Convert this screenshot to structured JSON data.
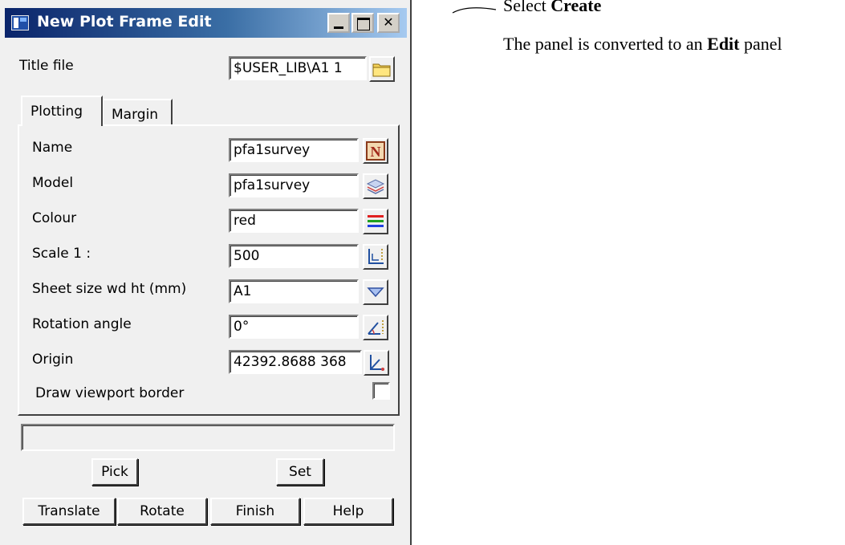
{
  "window": {
    "title": "New Plot Frame Edit",
    "title_file_label": "Title file",
    "title_file_value": "$USER_LIB\\A1 1"
  },
  "tabs": [
    {
      "label": "Plotting",
      "active": true
    },
    {
      "label": "Margin",
      "active": false
    }
  ],
  "fields": {
    "name": {
      "label": "Name",
      "value": "pfa1survey",
      "icon": "name-icon"
    },
    "model": {
      "label": "Model",
      "value": "pfa1survey",
      "icon": "layers-icon"
    },
    "colour": {
      "label": "Colour",
      "value": "red",
      "icon": "colour-bars-icon"
    },
    "scale": {
      "label": "Scale 1 :",
      "value": "500",
      "icon": "scale-icon"
    },
    "sheet": {
      "label": "Sheet size wd ht (mm)",
      "value": "A1",
      "icon": "chevron-down-icon"
    },
    "rotation": {
      "label": "Rotation angle",
      "value": "0°",
      "icon": "angle-icon"
    },
    "origin": {
      "label": "Origin",
      "value": "42392.8688 368",
      "icon": "axes-icon"
    }
  },
  "draw_border": {
    "label": "Draw viewport border",
    "checked": false
  },
  "status": "",
  "buttons": {
    "pick": "Pick",
    "set": "Set",
    "translate": "Translate",
    "rotate": "Rotate",
    "finish": "Finish",
    "help": "Help"
  },
  "annotation": {
    "select_prefix": "Select ",
    "select_bold": "Create",
    "desc_prefix": "The panel is converted to an ",
    "desc_bold": "Edit",
    "desc_suffix": " panel"
  },
  "colors": {
    "title_gradient_start": "#0a246a",
    "title_gradient_end": "#a6caf0",
    "panel_bg": "#f0f0f0"
  }
}
